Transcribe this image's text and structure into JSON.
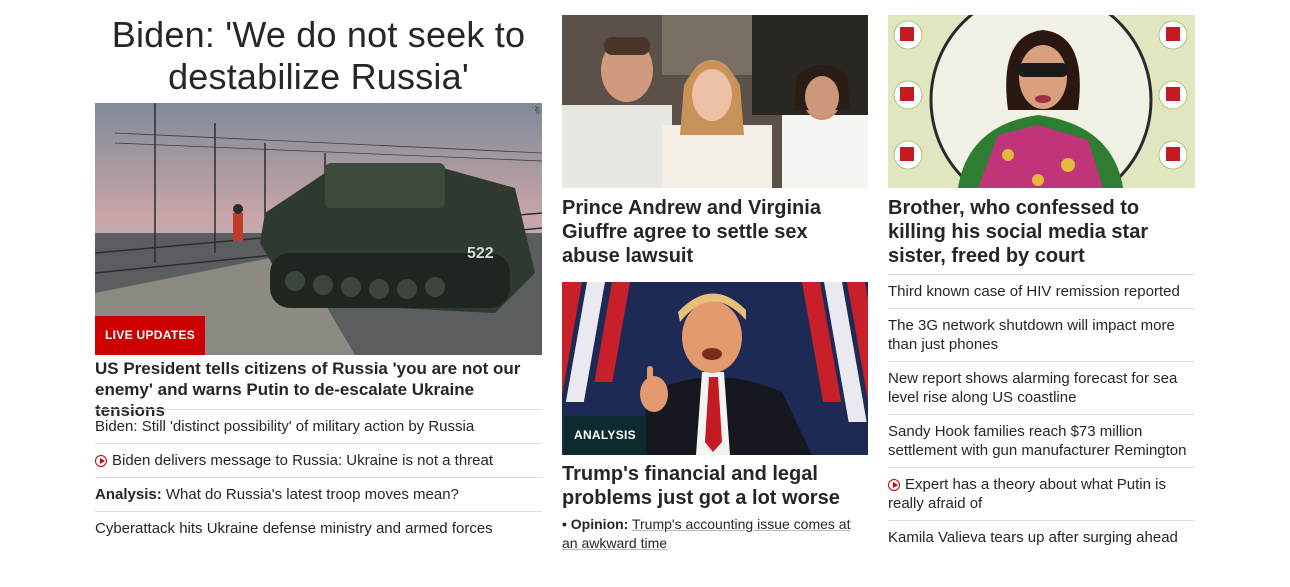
{
  "col1": {
    "headline": "Biden: 'We do not seek to destabilize Russia'",
    "hero_badge": "LIVE UPDATES",
    "hero_credit": "AP",
    "lead": "US President tells citizens of Russia 'you are not our enemy' and warns Putin to de-escalate Ukraine tensions",
    "items": [
      {
        "text": "Biden: Still 'distinct possibility' of military action by Russia"
      },
      {
        "text": "Biden delivers message to Russia: Ukraine is not a threat",
        "icon": "play-video-icon"
      },
      {
        "prefix": "Analysis:",
        "text": "What do Russia's latest troop moves mean?"
      },
      {
        "text": "Cyberattack hits Ukraine defense ministry and armed forces"
      }
    ]
  },
  "col2": {
    "story1_headline": "Prince Andrew and Virginia Giuffre agree to settle sex abuse lawsuit",
    "story2_badge": "ANALYSIS",
    "story2_headline": "Trump's financial and legal problems just got a lot worse",
    "story2_sub_prefix": "Opinion:",
    "story2_sub_text": "Trump's accounting issue comes at an awkward time"
  },
  "col3": {
    "headline": "Brother, who confessed to killing his social media star sister, freed by court",
    "items": [
      {
        "text": "Third known case of HIV remission reported"
      },
      {
        "text": "The 3G network shutdown will impact more than just phones"
      },
      {
        "text": "New report shows alarming forecast for sea level rise along US coastline"
      },
      {
        "text": "Sandy Hook families reach $73 million settlement with gun manufacturer Remington"
      },
      {
        "text": "Expert has a theory about what Putin is really afraid of",
        "icon": "play-video-icon"
      },
      {
        "text": "Kamila Valieva tears up after surging ahead"
      }
    ]
  },
  "colors": {
    "accent_red": "#cc0000",
    "badge_dark": "#0c2b2f",
    "text": "#262626"
  }
}
